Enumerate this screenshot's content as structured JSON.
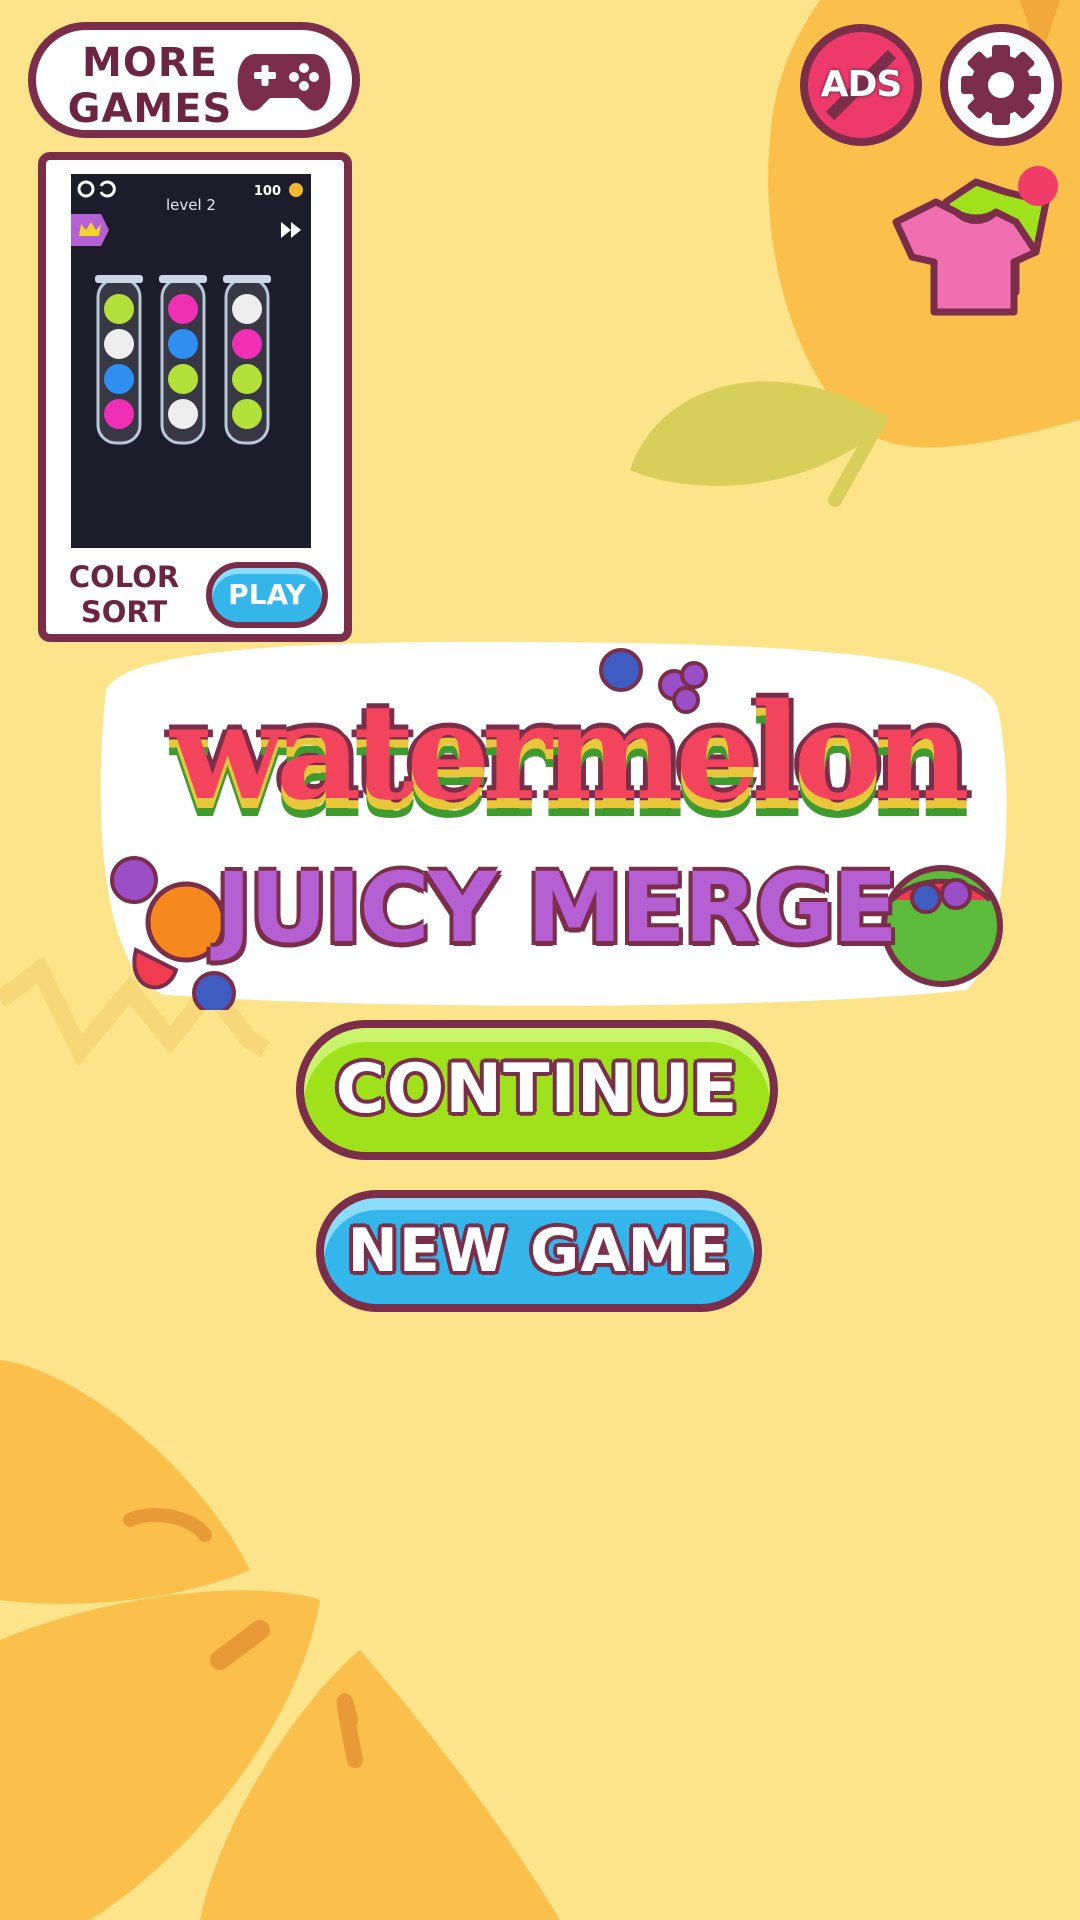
{
  "colors": {
    "background": "#fde389",
    "accent_dark": "#7a2e4a",
    "continue_green": "#9fe21c",
    "new_game_blue": "#35b6ea",
    "logo_red": "#f2445d",
    "logo_purple": "#b45fd2"
  },
  "header": {
    "more_games_line1": "MORE",
    "more_games_line2": "GAMES",
    "more_games_icon": "gamepad-icon",
    "no_ads_label": "ADS",
    "no_ads_icon": "no-ads-icon",
    "settings_icon": "gear-icon",
    "skins_icon": "tshirt-icon"
  },
  "ad_card": {
    "screen": {
      "level_label": "level 2",
      "coins": "100",
      "tubes": [
        [
          "green",
          "white",
          "blue",
          "pink"
        ],
        [
          "pink",
          "blue",
          "green",
          "white"
        ],
        [
          "white",
          "pink",
          "green",
          "green"
        ]
      ]
    },
    "title_line1": "COLOR",
    "title_line2": "SORT",
    "play_label": "PLAY"
  },
  "logo": {
    "word1": "watermelon",
    "word2": "JUICY MERGE"
  },
  "menu": {
    "continue_label": "CONTINUE",
    "new_game_label": "NEW GAME"
  }
}
